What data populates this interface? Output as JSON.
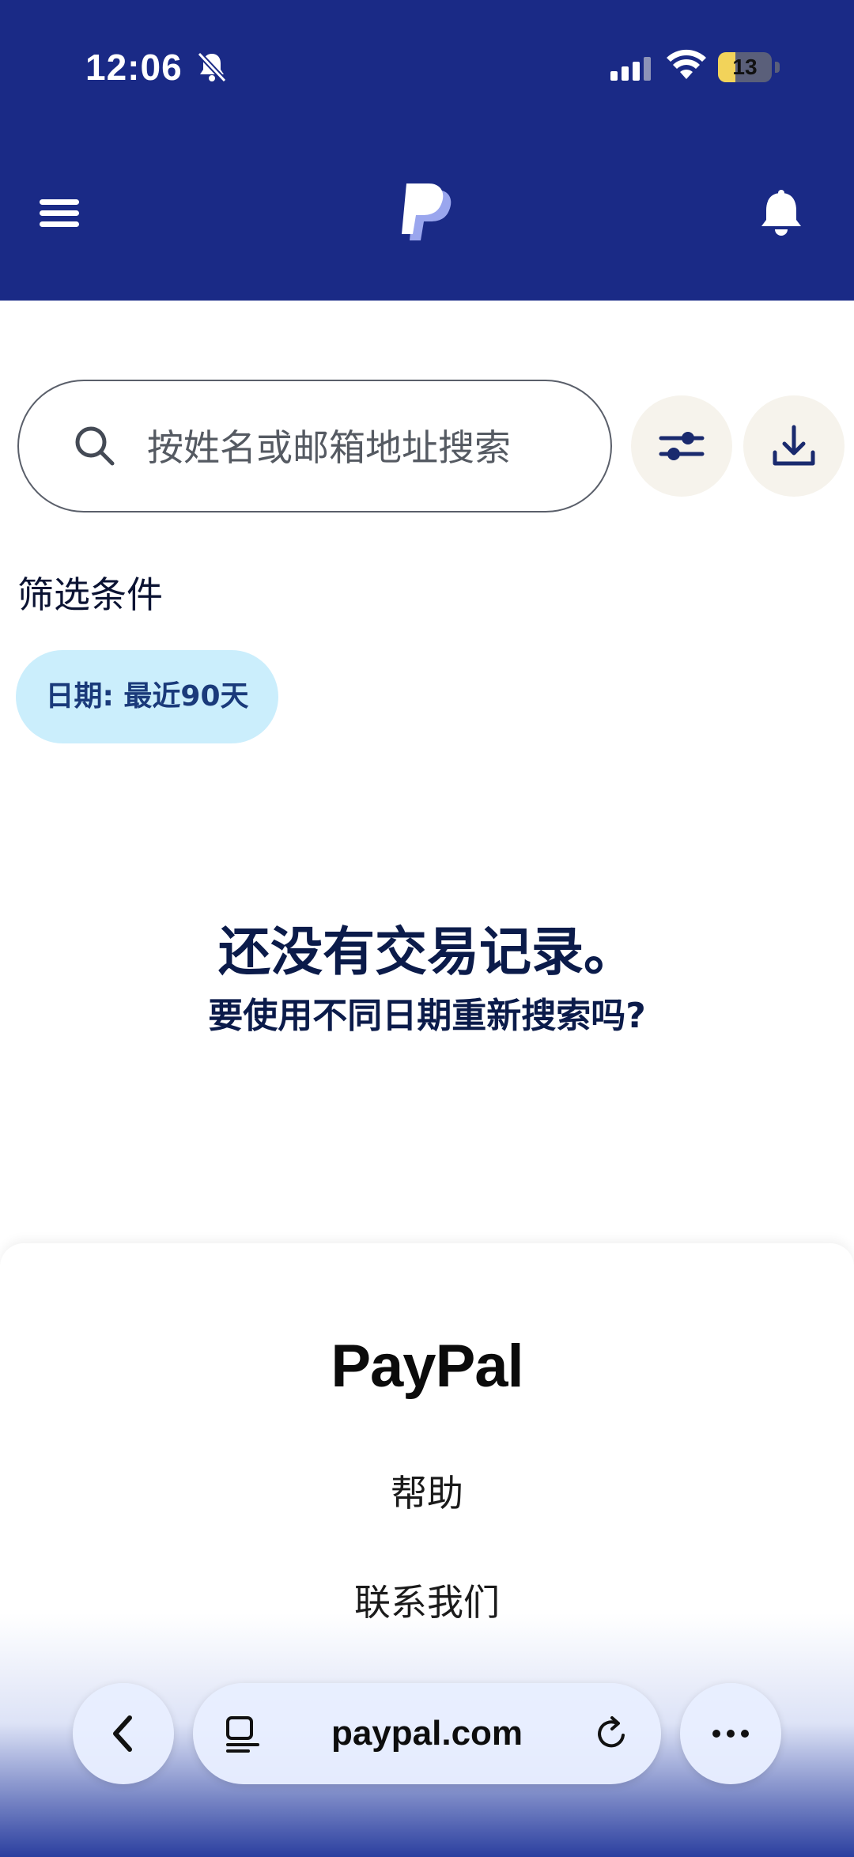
{
  "status_bar": {
    "time": "12:06",
    "battery_level": "13",
    "battery_fraction": 0.13
  },
  "header": {
    "menu_icon": "hamburger-menu-icon",
    "logo_icon": "paypal-p-logo",
    "notification_icon": "bell-icon",
    "colors": {
      "background": "#1a2a86"
    }
  },
  "search": {
    "placeholder": "按姓名或邮箱地址搜索",
    "value": ""
  },
  "filters": {
    "title": "筛选条件",
    "active_chip": "日期: 最近90天"
  },
  "empty_state": {
    "title": "还没有交易记录。",
    "subtitle": "要使用不同日期重新搜索吗?"
  },
  "footer": {
    "logo_text": "PayPal",
    "links": [
      "帮助",
      "联系我们"
    ]
  },
  "browser": {
    "url": "paypal.com"
  },
  "colors": {
    "brand_navy": "#1a2a86",
    "chip_bg": "#cbeefc",
    "text_dark": "#0b1b4a"
  }
}
